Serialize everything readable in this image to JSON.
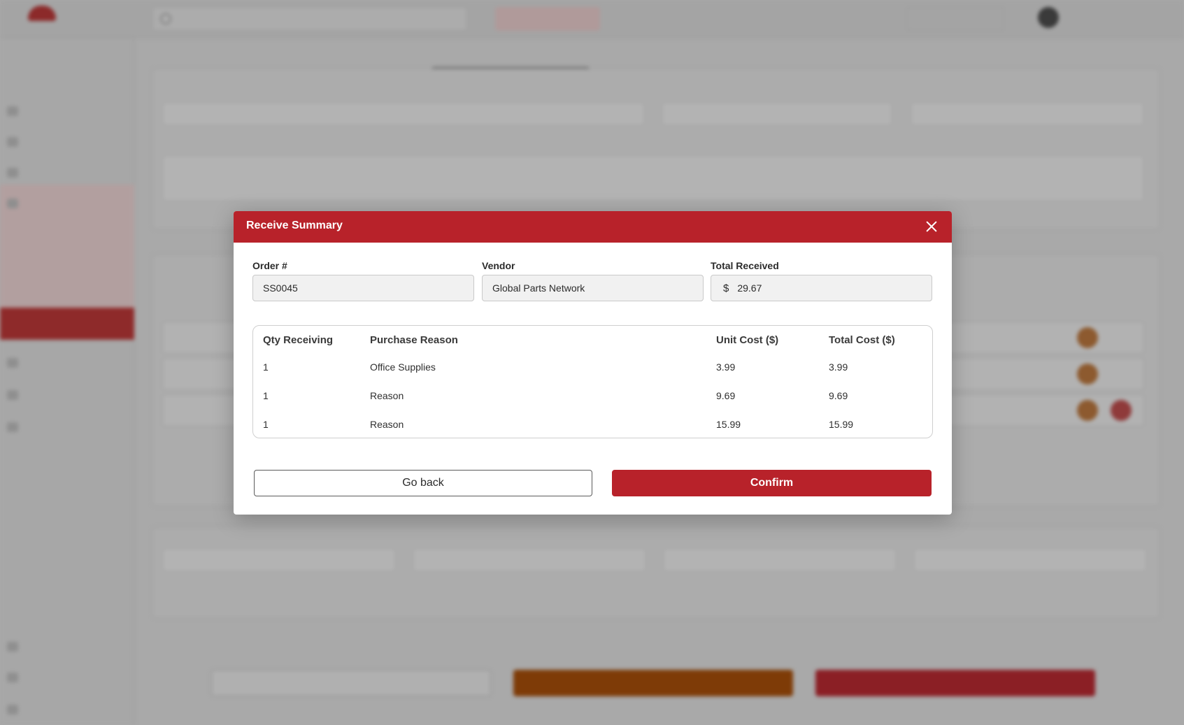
{
  "modal": {
    "title": "Receive Summary",
    "fields": {
      "order": {
        "label": "Order #",
        "value": "SS0045"
      },
      "vendor": {
        "label": "Vendor",
        "value": "Global Parts Network"
      },
      "total": {
        "label": "Total Received",
        "currency": "$",
        "value": "29.67"
      }
    },
    "table": {
      "headers": [
        "Qty Receiving",
        "Purchase Reason",
        "Unit Cost ($)",
        "Total Cost ($)"
      ],
      "rows": [
        {
          "qty": "1",
          "reason": "Office Supplies",
          "unit": "3.99",
          "total": "3.99"
        },
        {
          "qty": "1",
          "reason": "Reason",
          "unit": "9.69",
          "total": "9.69"
        },
        {
          "qty": "1",
          "reason": "Reason",
          "unit": "15.99",
          "total": "15.99"
        }
      ]
    },
    "buttons": {
      "back": "Go back",
      "confirm": "Confirm"
    }
  },
  "colors": {
    "brand": "#b8222a",
    "overlay": "#a9a9a9"
  }
}
